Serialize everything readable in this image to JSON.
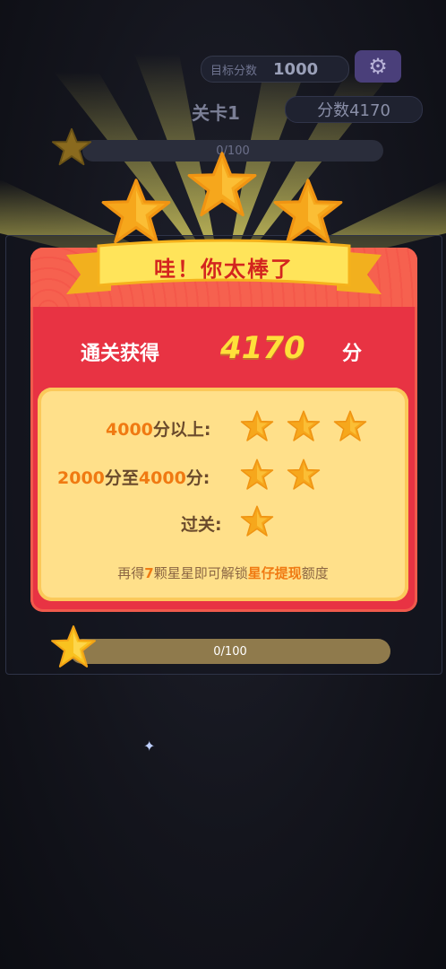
{
  "hud": {
    "target_label": "目标分数",
    "target_value": "1000",
    "gear_icon": "gear-icon",
    "level_title": "关卡1",
    "score_text": "分数4170",
    "top_progress_text": "0/100"
  },
  "dialog": {
    "ribbon_title": "哇！你太棒了",
    "earned_label": "通关获得",
    "earned_value": "4170",
    "earned_unit": "分",
    "earned_star_count": 3,
    "rules": [
      {
        "highlight": "4000",
        "text": "分以上:",
        "stars": 3
      },
      {
        "highlight_a": "2000",
        "mid": "分至",
        "highlight_b": "4000",
        "text": "分:",
        "stars": 2
      },
      {
        "text": "过关:",
        "stars": 1
      }
    ],
    "unlock": {
      "prefix": "再得",
      "count": "7",
      "middle": "颗星星即可解锁",
      "highlight": "星仔提现",
      "suffix": "额度"
    }
  },
  "bottom_progress": {
    "text": "0/100",
    "fraction": 0.0
  },
  "colors": {
    "dialog_red": "#e83343",
    "card_yellow": "#ffe08a",
    "star_gold": "#f6a71c",
    "highlight_orange": "#f07a12",
    "score_yellow": "#ffe03a"
  }
}
